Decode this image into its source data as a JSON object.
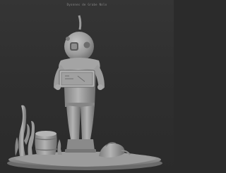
{
  "viewport": {
    "title": "Dyonnes de Grabe Nolo",
    "background_color": "#2f2f2f",
    "model_color": "#a6a6a6"
  },
  "model": {
    "subject": "deep-sea-diver-figurine",
    "icon": "diver-sculpt"
  }
}
